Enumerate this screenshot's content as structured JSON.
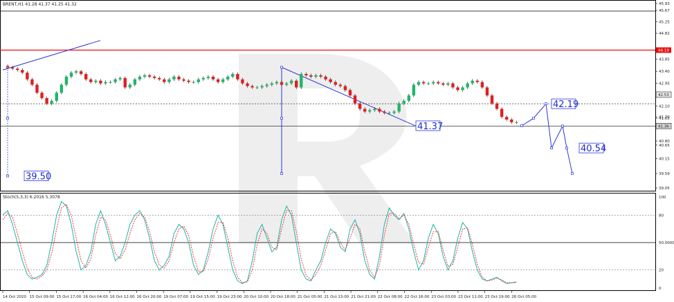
{
  "header": {
    "symbol_line": "BRENT,H1  41.28 41.37 41.25 41.32",
    "oscillator_line": "Stoch(5,3,3) 6.2016 5.3078"
  },
  "colors": {
    "bull": "#21b56a",
    "bear": "#e01f1f",
    "resistance": "#e81010",
    "forecast": "#2a35d8",
    "stoch_main": "#1fb3a6",
    "stoch_signal": "#e32727",
    "watermark": "#eeeeee"
  },
  "chart_data": [
    {
      "type": "candlestick",
      "symbol": "BRENT",
      "timeframe": "H1",
      "ylim": [
        39.59,
        45.93
      ],
      "y_tick_labels": [
        "45.93",
        "45.67",
        "45.25",
        "44.82",
        "44.19",
        "43.85",
        "43.40",
        "42.95",
        "42.53",
        "42.10",
        "41.70",
        "41.65",
        "41.36",
        "40.80",
        "40.65",
        "40.15",
        "39.59",
        "39.05"
      ],
      "x_tick_labels": [
        "14 Oct 2020",
        "15 Oct 09:00",
        "15 Oct 17:00",
        "16 Oct 04:00",
        "16 Oct 12:00",
        "16 Oct 20:00",
        "19 Oct 07:00",
        "19 Oct 15:00",
        "19 Oct 23:00",
        "20 Oct 10:00",
        "20 Oct 18:00",
        "21 Oct 05:00",
        "21 Oct 13:00",
        "21 Oct 21:00",
        "22 Oct 08:00",
        "22 Oct 16:00",
        "23 Oct 03:00",
        "23 Oct 11:00",
        "23 Oct 19:00",
        "26 Oct 05:00"
      ],
      "close_path": [
        43.6,
        43.55,
        43.5,
        43.45,
        43.35,
        43.1,
        42.9,
        42.6,
        42.4,
        42.2,
        42.3,
        42.6,
        42.9,
        43.2,
        43.35,
        43.4,
        43.3,
        43.1,
        43.0,
        43.05,
        42.95,
        43.0,
        43.0,
        43.1,
        43.15,
        42.8,
        42.9,
        43.1,
        43.2,
        43.25,
        43.2,
        43.15,
        43.1,
        43.0,
        43.1,
        43.2,
        43.1,
        43.05,
        43.0,
        43.0,
        43.1,
        43.15,
        43.2,
        43.1,
        43.0,
        43.1,
        43.2,
        43.3,
        43.1,
        42.95,
        42.85,
        42.8,
        42.8,
        42.85,
        42.9,
        42.95,
        43.0,
        42.9,
        42.95,
        43.05,
        42.8,
        43.3,
        43.25,
        43.2,
        43.25,
        43.2,
        43.1,
        43.0,
        42.9,
        42.85,
        42.7,
        42.5,
        42.2,
        42.0,
        41.9,
        41.95,
        42.0,
        41.9,
        41.85,
        41.85,
        41.9,
        42.2,
        42.3,
        42.5,
        42.9,
        43.0,
        42.95,
        42.95,
        43.0,
        42.95,
        42.9,
        42.95,
        42.8,
        42.7,
        42.8,
        42.95,
        43.05,
        43.0,
        42.8,
        42.5,
        42.2,
        42.0,
        41.7,
        41.6,
        41.5,
        41.5
      ],
      "series": [
        {
          "name": "Price",
          "values_ref": "close_path"
        },
        {
          "name": "Forecast",
          "points": [
            [
              "26 Oct 05:00",
              41.37
            ],
            [
              "26 Oct 20:00",
              42.19
            ],
            [
              "27 Oct 02:00",
              40.54
            ],
            [
              "27 Oct 09:00",
              41.36
            ],
            [
              "27 Oct 16:00",
              39.59
            ]
          ]
        }
      ],
      "levels": [
        {
          "name": "resistance",
          "value": 44.19,
          "style": "solid-red"
        },
        {
          "name": "level",
          "value": 42.19,
          "style": "dotted"
        },
        {
          "name": "level",
          "value": 41.36,
          "style": "solid"
        }
      ],
      "trendlines": [
        {
          "from": [
            "14 Oct 2020",
            43.45
          ],
          "to": [
            "16 Oct 09:00",
            44.55
          ]
        },
        {
          "from": [
            "20 Oct 18:00",
            43.55
          ],
          "to": [
            "22 Oct 10:00",
            41.37
          ]
        }
      ],
      "annotations": [
        {
          "text": "39.50",
          "value": 39.5
        },
        {
          "text": "41.37",
          "value": 41.37
        },
        {
          "text": "42.19",
          "value": 42.19
        },
        {
          "text": "40.54",
          "value": 40.54
        }
      ],
      "current_price_labels": [
        "42.53",
        "41.36"
      ]
    },
    {
      "type": "line",
      "name": "Stoch(5,3,3)",
      "ylim": [
        0,
        100
      ],
      "y_tick_labels": [
        "100",
        "80",
        "50.0000",
        "20",
        "0"
      ],
      "levels": [
        80,
        50,
        20
      ],
      "main_path": [
        80,
        85,
        70,
        50,
        30,
        15,
        10,
        12,
        15,
        25,
        50,
        80,
        95,
        90,
        70,
        40,
        20,
        25,
        40,
        70,
        85,
        70,
        50,
        30,
        35,
        50,
        70,
        80,
        85,
        75,
        55,
        30,
        20,
        25,
        35,
        60,
        70,
        65,
        50,
        25,
        15,
        20,
        40,
        65,
        80,
        70,
        45,
        20,
        8,
        5,
        8,
        30,
        60,
        70,
        55,
        40,
        45,
        75,
        90,
        80,
        50,
        20,
        10,
        8,
        20,
        30,
        50,
        65,
        60,
        45,
        40,
        65,
        75,
        60,
        30,
        15,
        10,
        35,
        70,
        88,
        80,
        75,
        82,
        65,
        40,
        20,
        30,
        55,
        70,
        60,
        35,
        20,
        30,
        55,
        72,
        65,
        40,
        20,
        10,
        8,
        10,
        12,
        8,
        5,
        6,
        7
      ],
      "signal_path": [
        75,
        82,
        78,
        60,
        40,
        22,
        12,
        10,
        13,
        20,
        38,
        65,
        88,
        92,
        80,
        55,
        30,
        22,
        32,
        58,
        78,
        75,
        58,
        38,
        32,
        42,
        60,
        75,
        82,
        78,
        62,
        40,
        25,
        22,
        30,
        50,
        65,
        68,
        58,
        35,
        18,
        18,
        32,
        55,
        72,
        72,
        55,
        30,
        12,
        6,
        7,
        20,
        48,
        65,
        60,
        45,
        42,
        65,
        85,
        85,
        62,
        32,
        14,
        9,
        15,
        25,
        42,
        60,
        62,
        50,
        42,
        55,
        70,
        65,
        40,
        20,
        12,
        25,
        58,
        82,
        82,
        76,
        80,
        70,
        48,
        28,
        26,
        45,
        62,
        62,
        42,
        24,
        26,
        45,
        65,
        66,
        48,
        26,
        12,
        8,
        9,
        11,
        9,
        6,
        6,
        6
      ]
    }
  ]
}
